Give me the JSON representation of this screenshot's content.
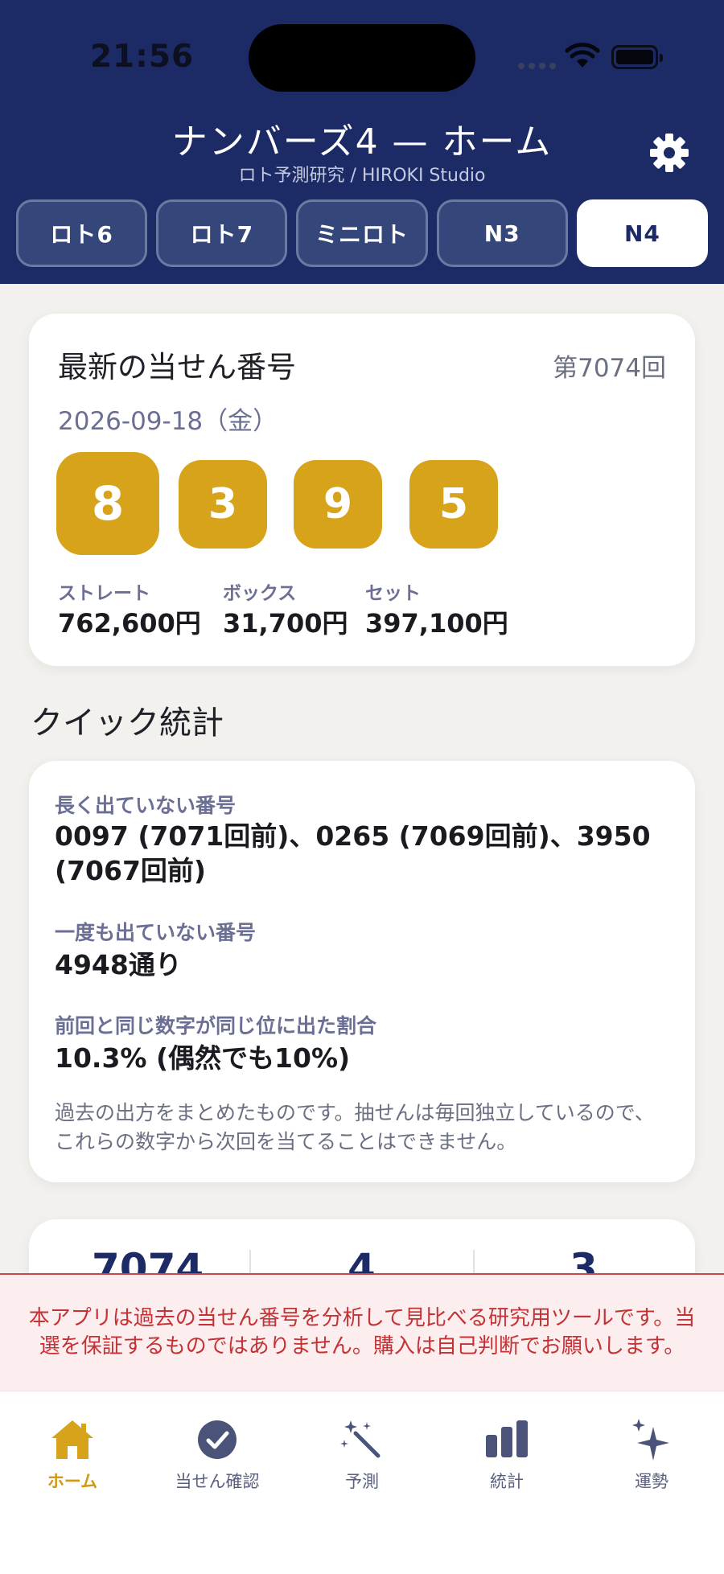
{
  "status_bar": {
    "time": "21:56"
  },
  "header": {
    "title": "ナンバーズ4 — ホーム",
    "subtitle": "ロト予測研究 / HIROKI Studio"
  },
  "tabs": [
    {
      "label": "ロト6",
      "active": false
    },
    {
      "label": "ロト7",
      "active": false
    },
    {
      "label": "ミニロト",
      "active": false
    },
    {
      "label": "N3",
      "active": false
    },
    {
      "label": "N4",
      "active": true
    }
  ],
  "latest": {
    "title": "最新の当せん番号",
    "draw_number": "第7074回",
    "date": "2026-09-18（金）",
    "numbers": [
      "8",
      "3",
      "9",
      "5"
    ],
    "prizes": [
      {
        "label": "ストレート",
        "value": "762,600円"
      },
      {
        "label": "ボックス",
        "value": "31,700円"
      },
      {
        "label": "セット",
        "value": "397,100円"
      }
    ]
  },
  "quick_stats": {
    "section_title": "クイック統計",
    "items": [
      {
        "label": "長く出ていない番号",
        "value": "0097 (7071回前)、0265 (7069回前)、3950 (7067回前)"
      },
      {
        "label": "一度も出ていない番号",
        "value": "4948通り"
      },
      {
        "label": "前回と同じ数字が同じ位に出た割合",
        "value": "10.3% (偶然でも10%)"
      }
    ],
    "note": "過去の出方をまとめたものです。抽せんは毎回独立しているので、これらの数字から次回を当てることはできません。"
  },
  "summary": {
    "values": [
      "7074",
      "4",
      "3"
    ]
  },
  "disclaimer": "本アプリは過去の当せん番号を分析して見比べる研究用ツールです。当選を保証するものではありません。購入は自己判断でお願いします。",
  "tabbar": [
    {
      "label": "ホーム",
      "icon": "home-icon",
      "active": true
    },
    {
      "label": "当せん確認",
      "icon": "checkmark-circle-icon",
      "active": false
    },
    {
      "label": "予測",
      "icon": "magic-wand-icon",
      "active": false
    },
    {
      "label": "統計",
      "icon": "bar-chart-icon",
      "active": false
    },
    {
      "label": "運勢",
      "icon": "sparkles-icon",
      "active": false
    }
  ],
  "colors": {
    "header": "#1c2b66",
    "accent": "#d6a31a",
    "warning": "#c43236"
  }
}
